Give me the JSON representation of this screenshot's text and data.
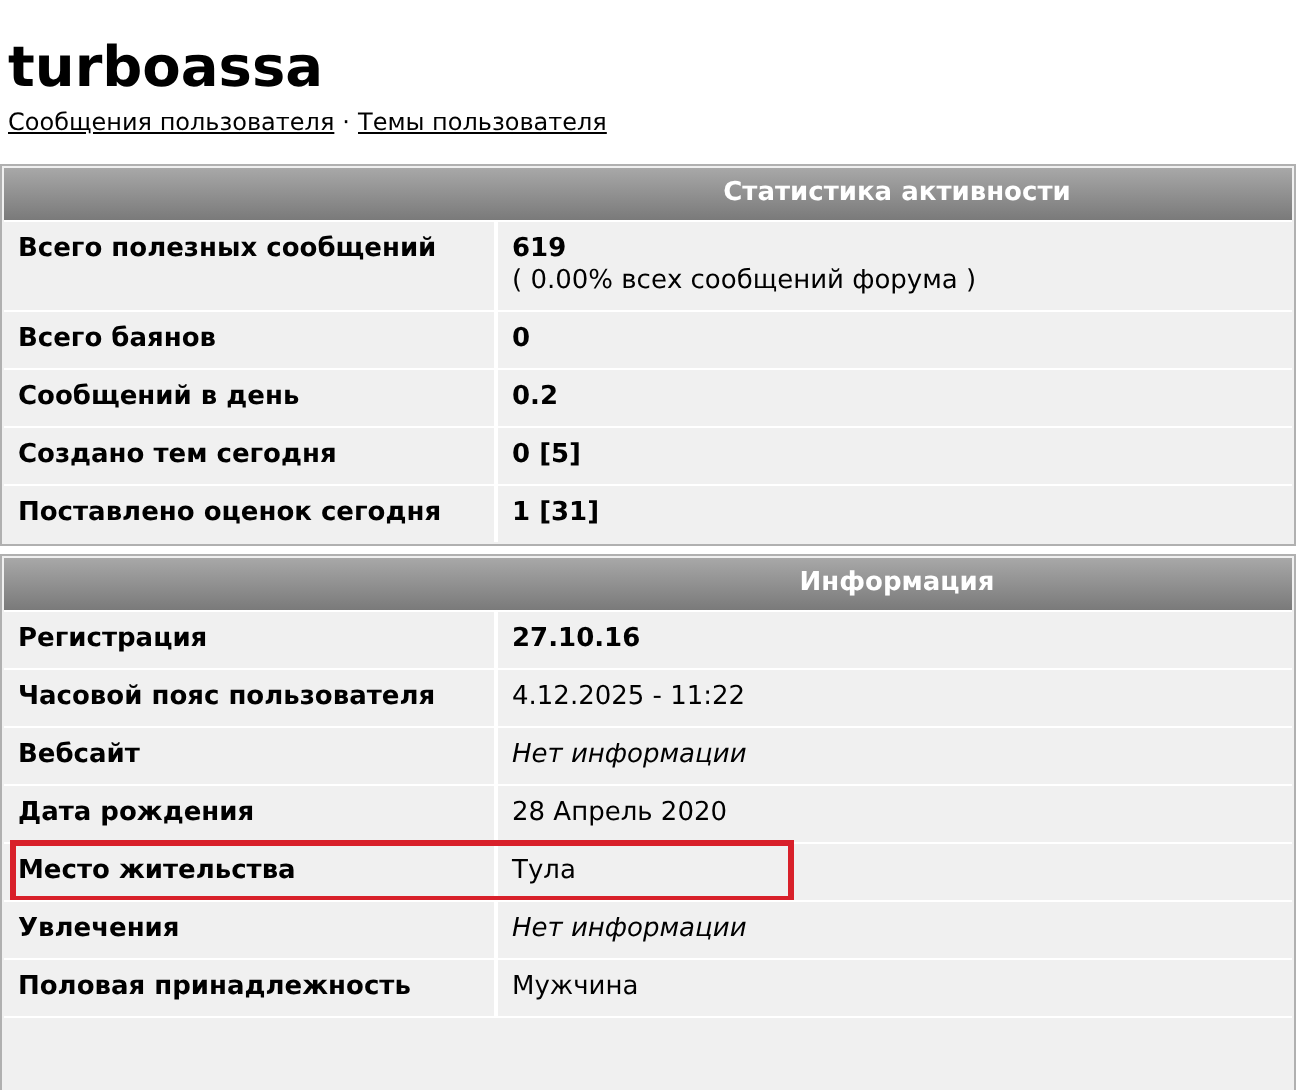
{
  "profile": {
    "username": "turboassa",
    "links": [
      {
        "label": "Сообщения пользователя"
      },
      {
        "label": "Темы пользователя"
      }
    ],
    "link_separator": "·"
  },
  "sections": [
    {
      "title": "Статистика активности",
      "rows": [
        {
          "label": "Всего полезных сообщений",
          "value": "619",
          "note": "( 0.00% всех сообщений форума )",
          "kind": "strong",
          "highlighted": false
        },
        {
          "label": "Всего баянов",
          "value": "0",
          "kind": "strong",
          "highlighted": false
        },
        {
          "label": "Сообщений в день",
          "value": "0.2",
          "kind": "strong",
          "highlighted": false
        },
        {
          "label": "Создано тем сегодня",
          "value": "0 [5]",
          "kind": "strong",
          "highlighted": false
        },
        {
          "label": "Поставлено оценок сегодня",
          "value": "1 [31]",
          "kind": "strong",
          "highlighted": false
        }
      ]
    },
    {
      "title": "Информация",
      "rows": [
        {
          "label": "Регистрация",
          "value": "27.10.16",
          "kind": "strong",
          "highlighted": false
        },
        {
          "label": "Часовой пояс пользователя",
          "value": "4.12.2025 - 11:22",
          "kind": "plain",
          "highlighted": false
        },
        {
          "label": "Вебсайт",
          "value": "Нет информации",
          "kind": "empty",
          "highlighted": false
        },
        {
          "label": "Дата рождения",
          "value": "28 Апрель 2020",
          "kind": "plain",
          "highlighted": false
        },
        {
          "label": "Место жительства",
          "value": "Тула",
          "kind": "plain",
          "highlighted": true
        },
        {
          "label": "Увлечения",
          "value": "Нет информации",
          "kind": "empty",
          "highlighted": false
        },
        {
          "label": "Половая принадлежность",
          "value": "Мужчина",
          "kind": "plain",
          "highlighted": false
        }
      ]
    }
  ]
}
